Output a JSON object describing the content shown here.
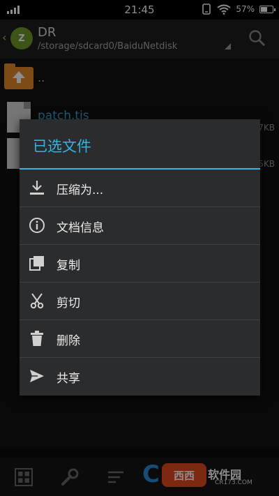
{
  "status": {
    "time": "21:45",
    "battery_pct": "57%",
    "battery_level": 0.57
  },
  "appbar": {
    "logo_text": "Z",
    "title": "DR",
    "path": "/storage/sdcard0/BaiduNetdisk"
  },
  "files": [
    {
      "name": "..",
      "type": "up"
    },
    {
      "name": "patch.tis",
      "size": "7KB"
    },
    {
      "name": "",
      "size": "5KB"
    }
  ],
  "dialog": {
    "title": "已选文件",
    "items": [
      {
        "label": "压缩为...",
        "icon": "download-icon"
      },
      {
        "label": "文档信息",
        "icon": "info-icon"
      },
      {
        "label": "复制",
        "icon": "copy-icon"
      },
      {
        "label": "剪切",
        "icon": "scissors-icon"
      },
      {
        "label": "删除",
        "icon": "trash-icon"
      },
      {
        "label": "共享",
        "icon": "send-icon"
      }
    ]
  },
  "toolbar": {
    "icons": [
      "grid-icon",
      "wrench-icon",
      "sort-icon"
    ]
  },
  "watermark": {
    "badge": "西西",
    "text": "软件园",
    "url": "CR173.COM"
  },
  "colors": {
    "accent": "#33b5e5",
    "dialog_bg": "#2b2c2e",
    "folder": "#e5892a"
  }
}
